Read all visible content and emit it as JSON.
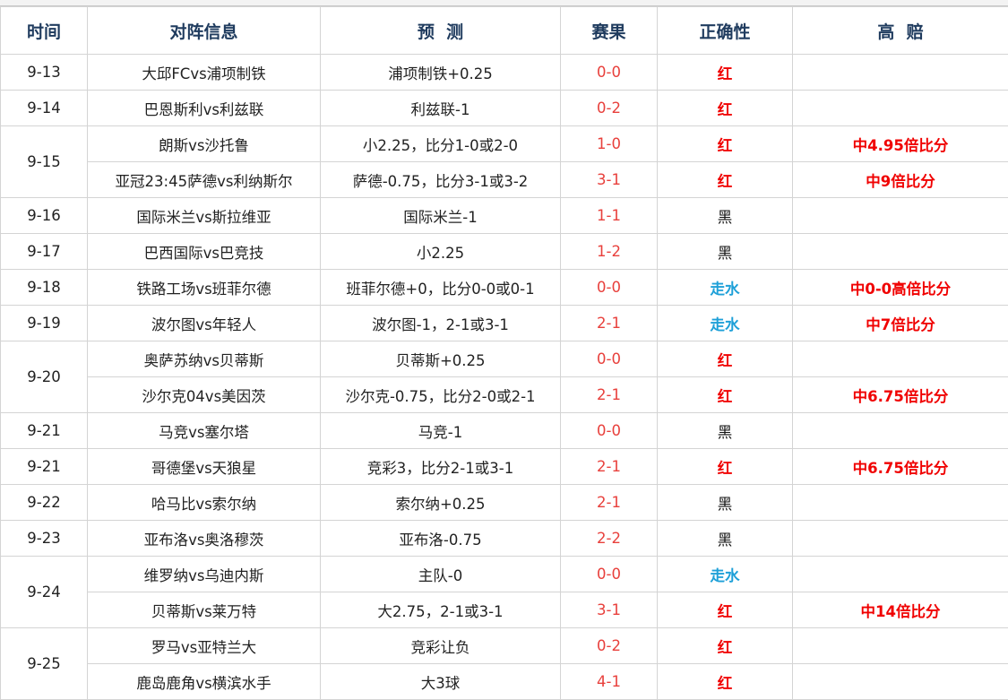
{
  "headers": {
    "date": "时间",
    "match": "对阵信息",
    "prediction": "预  测",
    "score": "赛果",
    "correctness": "正确性",
    "odds": "高  赔"
  },
  "result_colors": {
    "红": "#f00000",
    "黑": "#111111",
    "走水": "#1ea0d8"
  },
  "groups": [
    {
      "date": "9-13",
      "rows": [
        {
          "match": "大邱FCvs浦项制铁",
          "prediction": "浦项制铁+0.25",
          "score": "0-0",
          "result": "红",
          "odds": ""
        }
      ]
    },
    {
      "date": "9-14",
      "rows": [
        {
          "match": "巴恩斯利vs利兹联",
          "prediction": "利兹联-1",
          "score": "0-2",
          "result": "红",
          "odds": ""
        }
      ]
    },
    {
      "date": "9-15",
      "rows": [
        {
          "match": "朗斯vs沙托鲁",
          "prediction": "小2.25，比分1-0或2-0",
          "score": "1-0",
          "result": "红",
          "odds": "中4.95倍比分"
        },
        {
          "match": "亚冠23:45萨德vs利纳斯尔",
          "prediction": "萨德-0.75，比分3-1或3-2",
          "score": "3-1",
          "result": "红",
          "odds": "中9倍比分"
        }
      ]
    },
    {
      "date": "9-16",
      "rows": [
        {
          "match": "国际米兰vs斯拉维亚",
          "prediction": "国际米兰-1",
          "score": "1-1",
          "result": "黑",
          "odds": ""
        }
      ]
    },
    {
      "date": "9-17",
      "rows": [
        {
          "match": "巴西国际vs巴竞技",
          "prediction": "小2.25",
          "score": "1-2",
          "result": "黑",
          "odds": ""
        }
      ]
    },
    {
      "date": "9-18",
      "rows": [
        {
          "match": "铁路工场vs班菲尔德",
          "prediction": "班菲尔德+0，比分0-0或0-1",
          "score": "0-0",
          "result": "走水",
          "odds": "中0-0高倍比分"
        }
      ]
    },
    {
      "date": "9-19",
      "rows": [
        {
          "match": "波尔图vs年轻人",
          "prediction": "波尔图-1，2-1或3-1",
          "score": "2-1",
          "result": "走水",
          "odds": "中7倍比分"
        }
      ]
    },
    {
      "date": "9-20",
      "rows": [
        {
          "match": "奥萨苏纳vs贝蒂斯",
          "prediction": "贝蒂斯+0.25",
          "score": "0-0",
          "result": "红",
          "odds": ""
        },
        {
          "match": "沙尔克04vs美因茨",
          "prediction": "沙尔克-0.75，比分2-0或2-1",
          "score": "2-1",
          "result": "红",
          "odds": "中6.75倍比分"
        }
      ]
    },
    {
      "date": "9-21",
      "rows": [
        {
          "match": "马竞vs塞尔塔",
          "prediction": "马竞-1",
          "score": "0-0",
          "result": "黑",
          "odds": ""
        }
      ]
    },
    {
      "date": "9-21",
      "rows": [
        {
          "match": "哥德堡vs天狼星",
          "prediction": "竞彩3，比分2-1或3-1",
          "score": "2-1",
          "result": "红",
          "odds": "中6.75倍比分"
        }
      ]
    },
    {
      "date": "9-22",
      "rows": [
        {
          "match": "哈马比vs索尔纳",
          "prediction": "索尔纳+0.25",
          "score": "2-1",
          "result": "黑",
          "odds": ""
        }
      ]
    },
    {
      "date": "9-23",
      "rows": [
        {
          "match": "亚布洛vs奥洛穆茨",
          "prediction": "亚布洛-0.75",
          "score": "2-2",
          "result": "黑",
          "odds": ""
        }
      ]
    },
    {
      "date": "9-24",
      "rows": [
        {
          "match": "维罗纳vs乌迪内斯",
          "prediction": "主队-0",
          "score": "0-0",
          "result": "走水",
          "odds": ""
        },
        {
          "match": "贝蒂斯vs莱万特",
          "prediction": "大2.75，2-1或3-1",
          "score": "3-1",
          "result": "红",
          "odds": "中14倍比分"
        }
      ]
    },
    {
      "date": "9-25",
      "rows": [
        {
          "match": "罗马vs亚特兰大",
          "prediction": "竞彩让负",
          "score": "0-2",
          "result": "红",
          "odds": ""
        },
        {
          "match": "鹿岛鹿角vs横滨水手",
          "prediction": "大3球",
          "score": "4-1",
          "result": "红",
          "odds": ""
        }
      ]
    }
  ]
}
